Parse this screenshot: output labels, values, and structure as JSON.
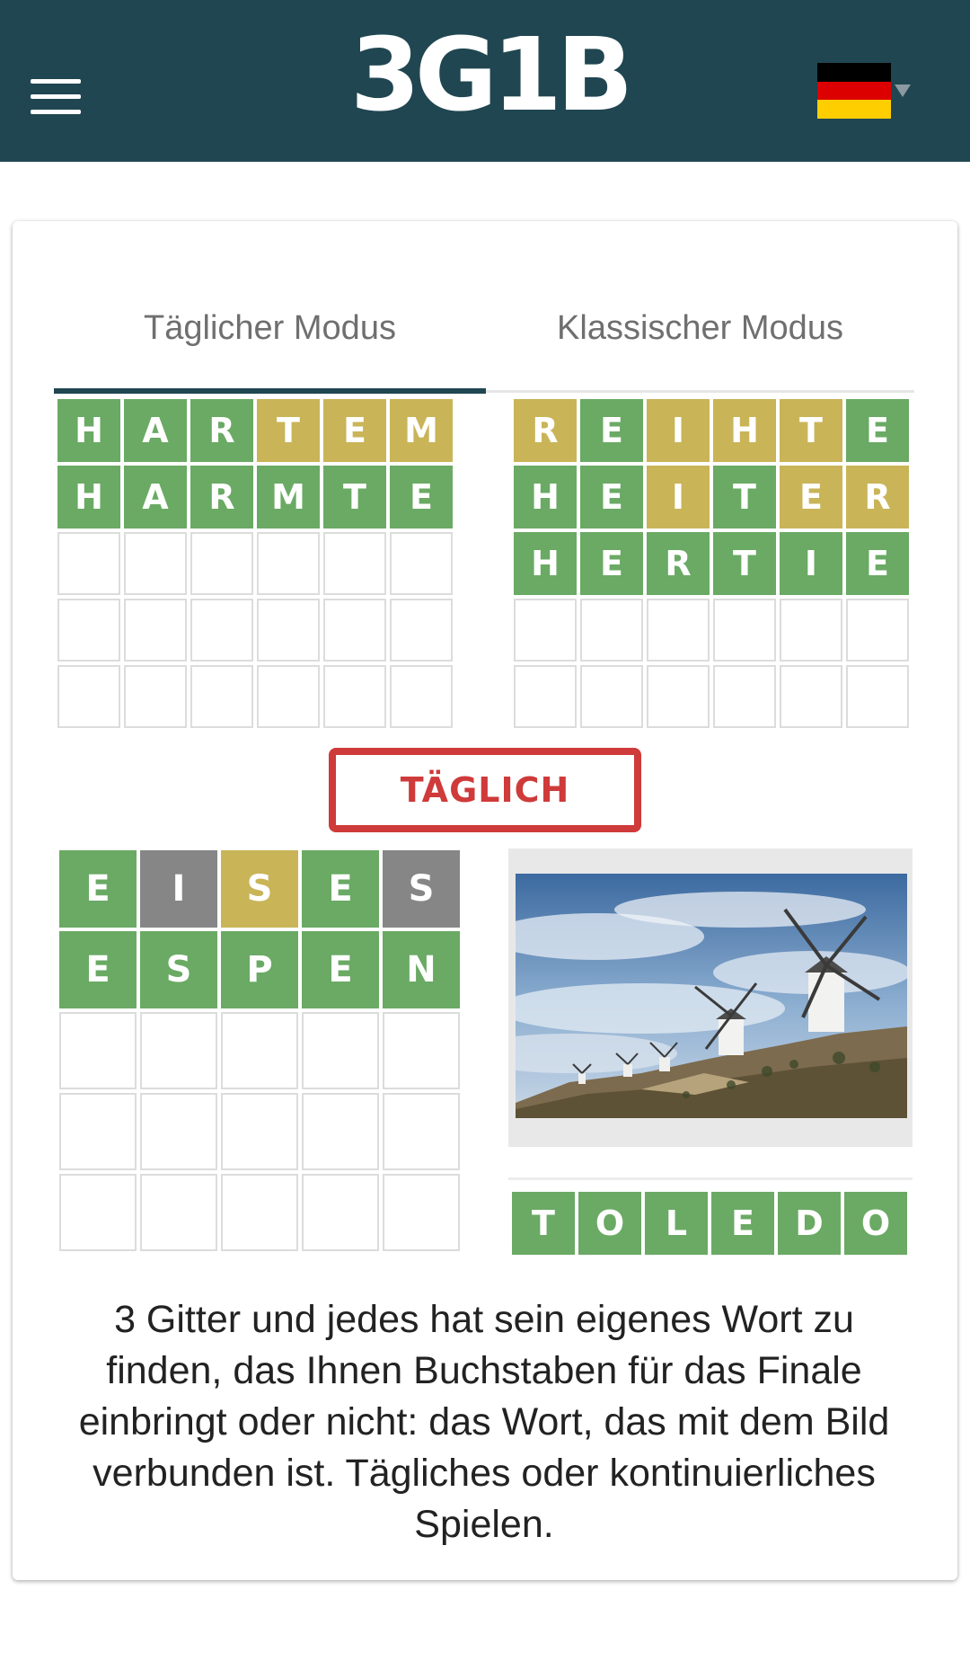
{
  "header": {
    "logo_text": "3G1B",
    "menu_icon": "hamburger-menu-icon",
    "language_flag": "germany-flag-icon",
    "flag_colors": [
      "#000000",
      "#dd0000",
      "#ffce00"
    ]
  },
  "tabs": [
    {
      "label": "Täglicher Modus",
      "active": true
    },
    {
      "label": "Klassischer Modus",
      "active": false
    }
  ],
  "colors": {
    "correct": "#6aaa64",
    "present": "#c9b458",
    "absent": "#868686",
    "accent": "#204651",
    "stamp": "#cf3a3a"
  },
  "grids": {
    "top_left": {
      "rows": [
        [
          {
            "l": "H",
            "s": "g"
          },
          {
            "l": "A",
            "s": "g"
          },
          {
            "l": "R",
            "s": "g"
          },
          {
            "l": "T",
            "s": "y"
          },
          {
            "l": "E",
            "s": "y"
          },
          {
            "l": "M",
            "s": "y"
          }
        ],
        [
          {
            "l": "H",
            "s": "g"
          },
          {
            "l": "A",
            "s": "g"
          },
          {
            "l": "R",
            "s": "g"
          },
          {
            "l": "M",
            "s": "g"
          },
          {
            "l": "T",
            "s": "g"
          },
          {
            "l": "E",
            "s": "g"
          }
        ]
      ],
      "total_rows": 5,
      "cols": 6
    },
    "top_right": {
      "rows": [
        [
          {
            "l": "R",
            "s": "y"
          },
          {
            "l": "E",
            "s": "g"
          },
          {
            "l": "I",
            "s": "y"
          },
          {
            "l": "H",
            "s": "y"
          },
          {
            "l": "T",
            "s": "y"
          },
          {
            "l": "E",
            "s": "g"
          }
        ],
        [
          {
            "l": "H",
            "s": "g"
          },
          {
            "l": "E",
            "s": "g"
          },
          {
            "l": "I",
            "s": "y"
          },
          {
            "l": "T",
            "s": "g"
          },
          {
            "l": "E",
            "s": "y"
          },
          {
            "l": "R",
            "s": "y"
          }
        ],
        [
          {
            "l": "H",
            "s": "g"
          },
          {
            "l": "E",
            "s": "g"
          },
          {
            "l": "R",
            "s": "g"
          },
          {
            "l": "T",
            "s": "g"
          },
          {
            "l": "I",
            "s": "g"
          },
          {
            "l": "E",
            "s": "g"
          }
        ]
      ],
      "total_rows": 5,
      "cols": 6
    },
    "bottom_left": {
      "rows": [
        [
          {
            "l": "E",
            "s": "g"
          },
          {
            "l": "I",
            "s": "x"
          },
          {
            "l": "S",
            "s": "y"
          },
          {
            "l": "E",
            "s": "g"
          },
          {
            "l": "S",
            "s": "x"
          }
        ],
        [
          {
            "l": "E",
            "s": "g"
          },
          {
            "l": "S",
            "s": "g"
          },
          {
            "l": "P",
            "s": "g"
          },
          {
            "l": "E",
            "s": "g"
          },
          {
            "l": "N",
            "s": "g"
          }
        ]
      ],
      "total_rows": 5,
      "cols": 5
    },
    "answer": {
      "rows": [
        [
          {
            "l": "T",
            "s": "g"
          },
          {
            "l": "O",
            "s": "g"
          },
          {
            "l": "L",
            "s": "g"
          },
          {
            "l": "E",
            "s": "g"
          },
          {
            "l": "D",
            "s": "g"
          },
          {
            "l": "O",
            "s": "g"
          }
        ]
      ],
      "total_rows": 1,
      "cols": 6
    }
  },
  "stamp_label": "TÄGLICH",
  "image_subject": "windmills-on-hill-photo",
  "description": "3 Gitter und jedes hat sein eigenes Wort zu finden, das Ihnen Buchstaben für das Finale einbringt oder nicht: das Wort, das mit dem Bild verbunden ist. Tägliches oder kontinuierliches Spielen."
}
